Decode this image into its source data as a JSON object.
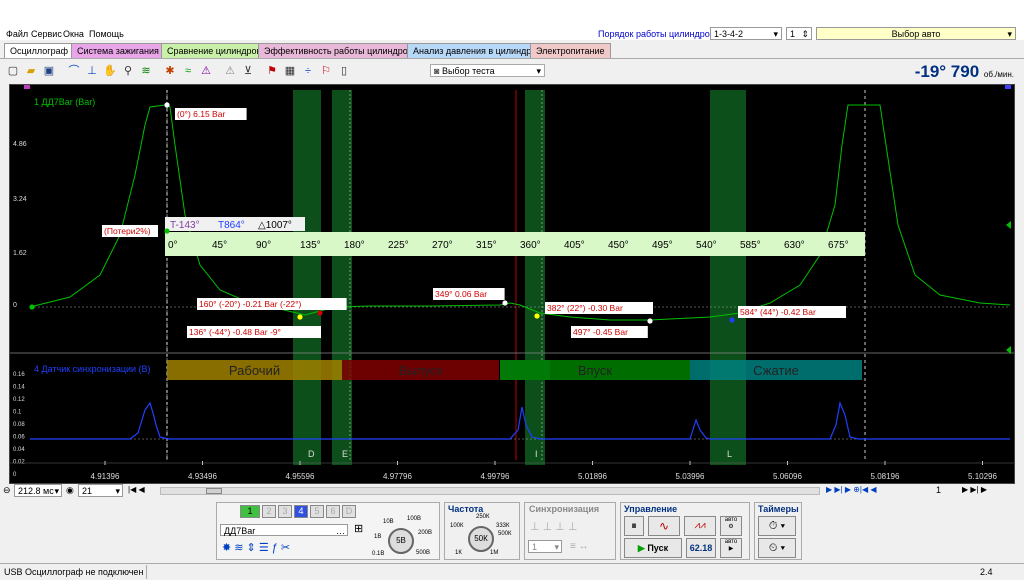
{
  "menu": {
    "file": "Файл",
    "service": "Сервис",
    "windows": "Окна",
    "help": "Помощь"
  },
  "cylinder_order": {
    "label": "Порядок работы цилиндров",
    "value": "1-3-4-2",
    "spin": "1",
    "car_select": "Выбор авто"
  },
  "tabs": [
    "Осциллограф",
    "Система зажигания",
    "Сравнение цилиндров",
    "Эффективность работы цилиндров",
    "Анализ давления в цилиндре",
    "Электропитание"
  ],
  "tab_colors": [
    "#f0f0f0",
    "#e8a6e8",
    "#c8f0a8",
    "#e8b8d8",
    "#b8d8f8",
    "#f0c8c8"
  ],
  "toolbar": {
    "test_select": "Выбор теста"
  },
  "rpm": {
    "value": "-19° 790",
    "unit": "об./мин."
  },
  "channel1": {
    "name": "1 ДД7Bar (Bar)",
    "y_ticks": [
      "4.86",
      "3.24",
      "1.62",
      "0"
    ]
  },
  "channel4": {
    "name": "4 Датчик синхронизации (В)",
    "y_ticks": [
      "0.16",
      "0.14",
      "0.12",
      "0.1",
      "0.08",
      "0.06",
      "0.04",
      "0.02",
      "0",
      "-0.04"
    ]
  },
  "cursor_bar": {
    "left": "-143°",
    "right": "864°",
    "delta": "1007°"
  },
  "degree_scale": [
    "0°",
    "45°",
    "90°",
    "135°",
    "180°",
    "225°",
    "270°",
    "315°",
    "360°",
    "405°",
    "450°",
    "495°",
    "540°",
    "585°",
    "630°",
    "675°"
  ],
  "annotations": {
    "peak": "(0°) 6.15 Bar",
    "loss": "(Потери2%)",
    "a1": "160° (-20°) -0.21 Bar (-22°)",
    "a2": "136° (-44°) -0.48 Bar -9°",
    "a3": "349° 0.06 Bar",
    "a4": "382° (22°) -0.30 Bar",
    "a5": "497° -0.45 Bar",
    "a6": "584° (44°) -0.42 Bar"
  },
  "phases": [
    "Рабочий",
    "Выпуск",
    "Впуск",
    "Сжатие"
  ],
  "markers": [
    "D",
    "E",
    "I",
    "L"
  ],
  "x_ticks": [
    "4.91396",
    "4.93496",
    "4.95596",
    "4.97796",
    "4.99796",
    "5.01896",
    "5.03996",
    "5.06096",
    "5.08196",
    "5.10296"
  ],
  "timebase": {
    "value": "212.8 мс",
    "channel": "21"
  },
  "page_number": "1",
  "channels": [
    "1",
    "2",
    "3",
    "4",
    "5",
    "6",
    "D"
  ],
  "sensor_name": "ДД7Bar",
  "knob_voltage": {
    "center": "5В",
    "labels": [
      "10В",
      "100В",
      "1В",
      "200В",
      "0.1В",
      "500В"
    ]
  },
  "frequency": {
    "title": "Частота",
    "center": "50К",
    "labels": [
      "250К",
      "100К",
      "333К",
      "500К",
      "1К",
      "1М"
    ]
  },
  "sync": {
    "title": "Синхронизация",
    "value": "1"
  },
  "control": {
    "title": "Управление",
    "start": "Пуск",
    "value": "62.18",
    "auto": "авто"
  },
  "timers": {
    "title": "Таймеры"
  },
  "status": {
    "message": "USB Осциллограф не подключен",
    "version": "2.4"
  }
}
